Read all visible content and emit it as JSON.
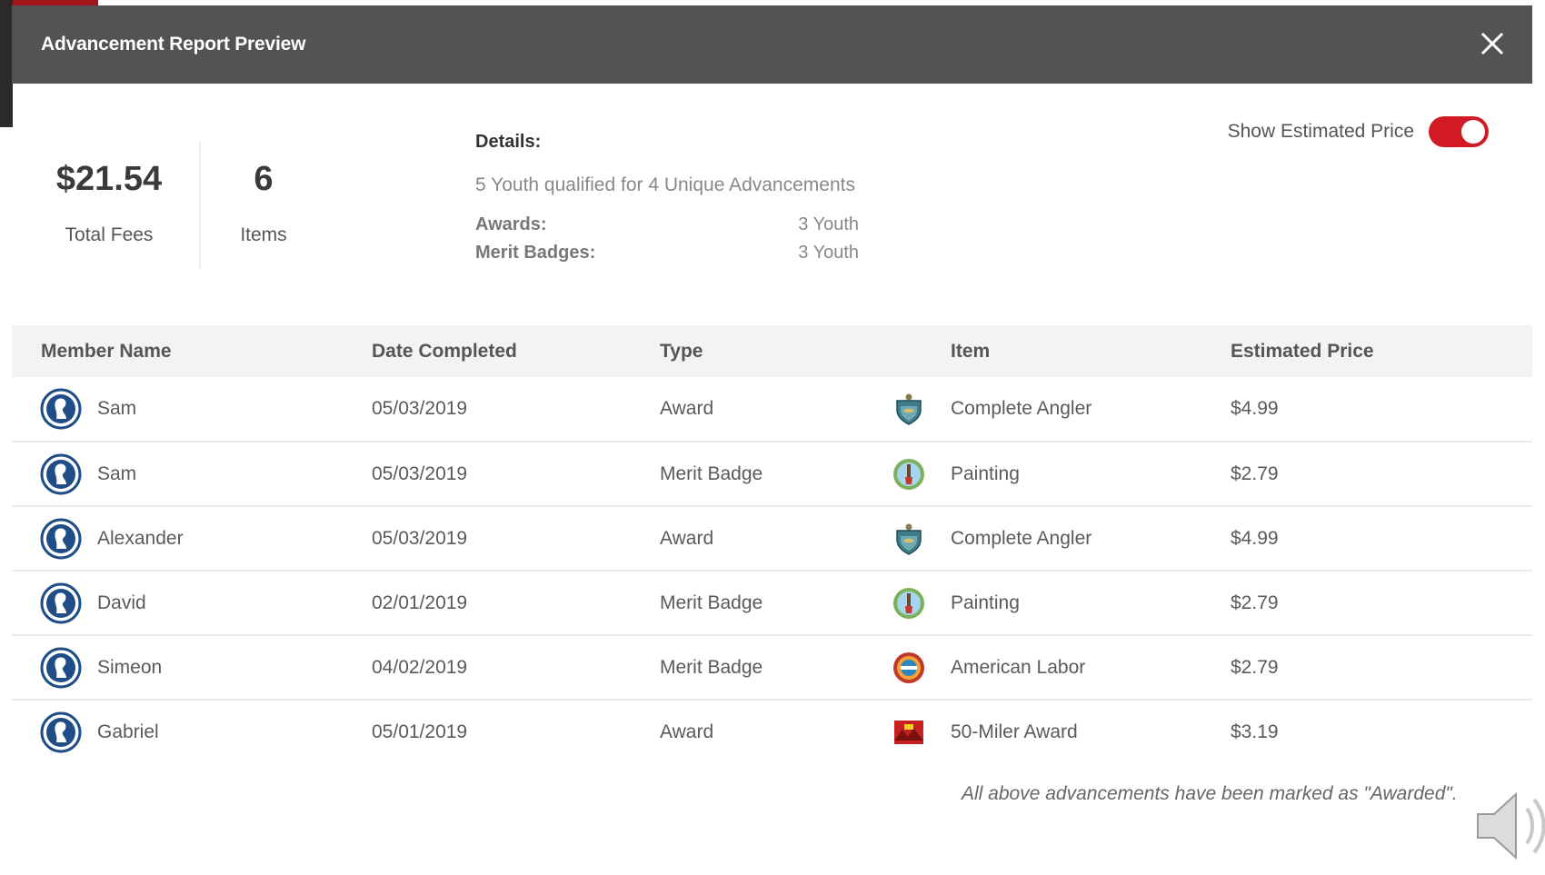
{
  "modal": {
    "title": "Advancement Report Preview",
    "close_icon": "close-icon"
  },
  "summary": {
    "total_fees_value": "$21.54",
    "total_fees_label": "Total Fees",
    "items_value": "6",
    "items_label": "Items"
  },
  "details": {
    "title": "Details:",
    "summary": "5 Youth qualified for 4 Unique Advancements",
    "rows": [
      {
        "label": "Awards:",
        "value": "3 Youth"
      },
      {
        "label": "Merit Badges:",
        "value": "3 Youth"
      }
    ]
  },
  "toggle": {
    "label": "Show Estimated Price",
    "state": "on",
    "color": "#d21a24"
  },
  "table": {
    "headers": {
      "member": "Member Name",
      "date": "Date Completed",
      "type": "Type",
      "item": "Item",
      "price": "Estimated Price"
    },
    "rows": [
      {
        "member": "Sam",
        "date": "05/03/2019",
        "type": "Award",
        "item": "Complete Angler",
        "icon": "award-shield-icon",
        "price": "$4.99"
      },
      {
        "member": "Sam",
        "date": "05/03/2019",
        "type": "Merit Badge",
        "item": "Painting",
        "icon": "painting-badge-icon",
        "price": "$2.79"
      },
      {
        "member": "Alexander",
        "date": "05/03/2019",
        "type": "Award",
        "item": "Complete Angler",
        "icon": "award-shield-icon",
        "price": "$4.99"
      },
      {
        "member": "David",
        "date": "02/01/2019",
        "type": "Merit Badge",
        "item": "Painting",
        "icon": "painting-badge-icon",
        "price": "$2.79"
      },
      {
        "member": "Simeon",
        "date": "04/02/2019",
        "type": "Merit Badge",
        "item": "American Labor",
        "icon": "american-labor-badge-icon",
        "price": "$2.79"
      },
      {
        "member": "Gabriel",
        "date": "05/01/2019",
        "type": "Award",
        "item": "50-Miler Award",
        "icon": "fifty-miler-award-icon",
        "price": "$3.19"
      }
    ]
  },
  "footer_note": "All above advancements have been marked as \"Awarded\".",
  "colors": {
    "header_bg": "#535356",
    "accent_red": "#d21a24",
    "avatar_blue": "#1f4e86"
  }
}
